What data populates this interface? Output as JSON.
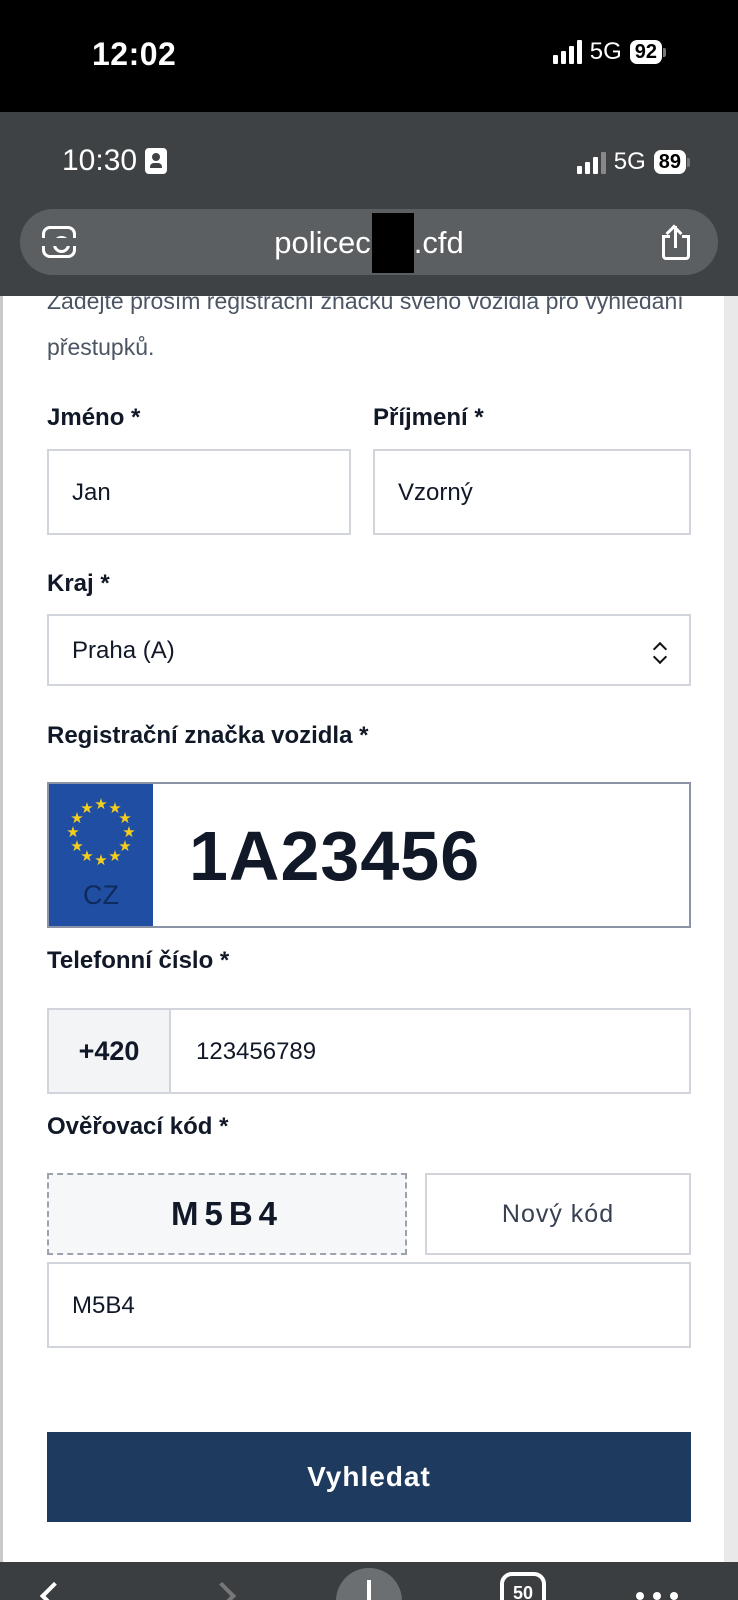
{
  "device_status": {
    "time": "12:02",
    "network": "5G",
    "battery": "92"
  },
  "browser": {
    "status_time": "10:30",
    "network": "5G",
    "battery": "89",
    "url": "policec  nu.cfd",
    "tab_count": "50"
  },
  "form": {
    "intro": "Zadejte prosím registrační značku svého vozidla pro vyhledání přestupků.",
    "first_name": {
      "label": "Jméno *",
      "value": "Jan"
    },
    "last_name": {
      "label": "Příjmení *",
      "value": "Vzorný"
    },
    "region": {
      "label": "Kraj *",
      "value": "Praha (A)"
    },
    "plate": {
      "label": "Registrační značka vozidla *",
      "country_code": "CZ",
      "value": "1A23456"
    },
    "phone": {
      "label": "Telefonní číslo *",
      "prefix": "+420",
      "value": "123456789"
    },
    "verification": {
      "label": "Ověřovací kód *",
      "captcha": "M5B4",
      "refresh_label": "Nový kód",
      "value": "M5B4"
    },
    "submit_label": "Vyhledat"
  },
  "colors": {
    "primary_button": "#1e3a5f",
    "eu_blue": "#1f4ea3",
    "eu_yellow": "#f5cf1b"
  }
}
